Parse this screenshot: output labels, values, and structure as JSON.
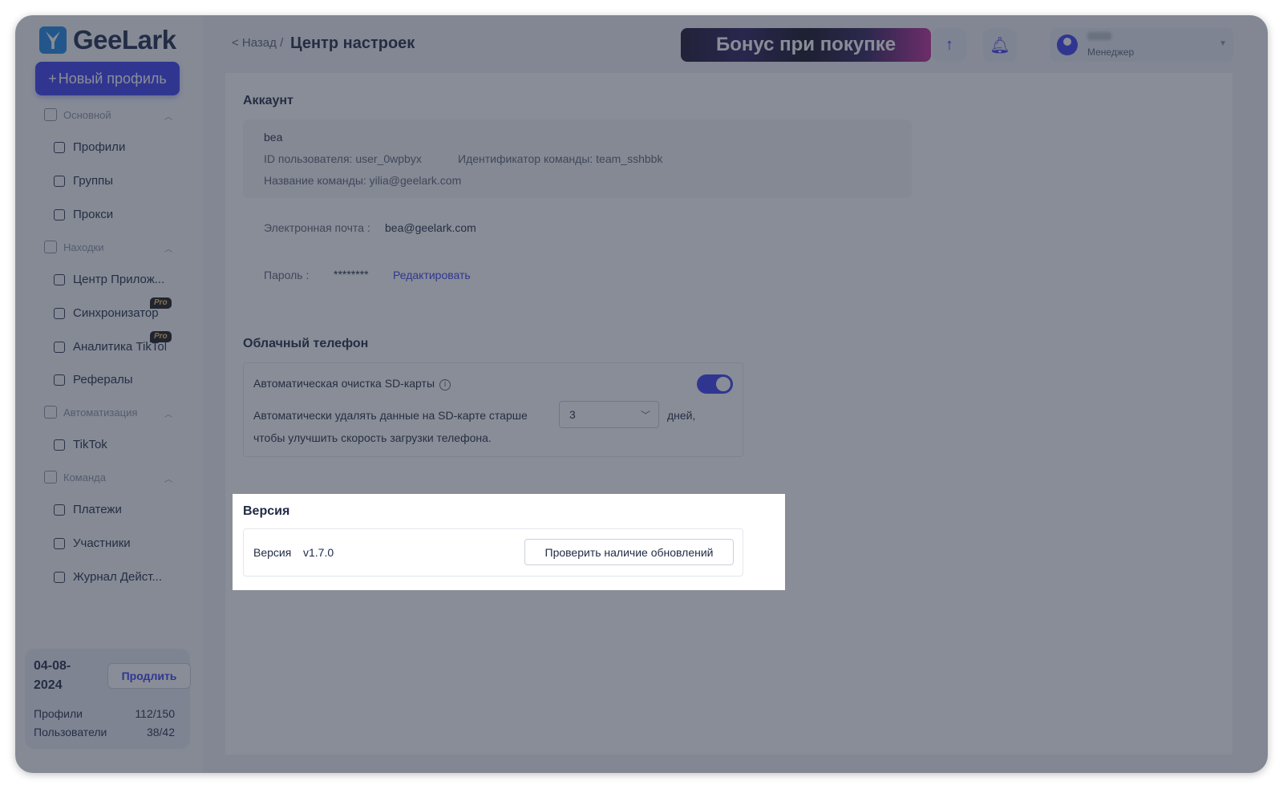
{
  "app": {
    "name": "GeeLark"
  },
  "sidebar": {
    "new_profile_label": "Новый профиль",
    "sections": [
      {
        "label": "Основной"
      },
      {
        "label": "Находки"
      },
      {
        "label": "Автоматизация"
      },
      {
        "label": "Команда"
      }
    ],
    "items": [
      {
        "label": "Профили"
      },
      {
        "label": "Группы"
      },
      {
        "label": "Прокси"
      },
      {
        "label": "Центр Прилож..."
      },
      {
        "label": "Синхронизатор",
        "badge": "Pro"
      },
      {
        "label": "Аналитика TikTok",
        "badge": "Pro"
      },
      {
        "label": "Рефералы"
      },
      {
        "label": "TikTok"
      },
      {
        "label": "Платежи"
      },
      {
        "label": "Участники"
      },
      {
        "label": "Журнал Дейст..."
      }
    ],
    "subscription": {
      "date": "04-08-2024",
      "renew_label": "Продлить",
      "profiles_label": "Профили",
      "profiles_value": "112/150",
      "users_label": "Пользователи",
      "users_value": "38/42"
    }
  },
  "header": {
    "back_label": "< Назад /",
    "title": "Центр настроек",
    "banner_text": "Бонус при покупке",
    "user_role": "Менеджер"
  },
  "account": {
    "section_title": "Аккаунт",
    "username": "bea",
    "user_id_label": "ID пользователя: user_0wpbyx",
    "team_id_label": "Идентификатор команды: team_sshbbk",
    "team_name_label": "Название команды: yilia@geelark.com",
    "email_label": "Электронная почта :",
    "email_value": "bea@geelark.com",
    "password_label": "Пароль :",
    "password_value": "********",
    "edit_label": "Редактировать"
  },
  "cloud_phone": {
    "section_title": "Облачный телефон",
    "auto_clean_label": "Автоматическая очистка SD-карты",
    "auto_clean_enabled": true,
    "delete_prefix": "Автоматически удалять данные на SD-карте старше",
    "delete_days": "3",
    "delete_suffix": "дней,",
    "delete_line2": "чтобы улучшить скорость загрузки телефона."
  },
  "version": {
    "section_title": "Версия",
    "label": "Версия",
    "value": "v1.7.0",
    "check_button": "Проверить наличие обновлений"
  },
  "colors": {
    "accent": "#3b3ff0",
    "overlay": "#283042"
  }
}
